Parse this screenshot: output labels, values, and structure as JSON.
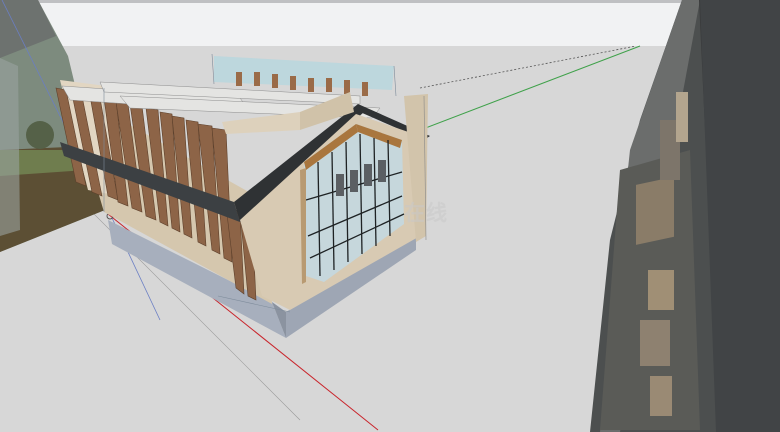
{
  "viewport": {
    "watermark_text": "在线",
    "colors": {
      "sky": "#f1f2f3",
      "ground": "#d7d7d7",
      "roof": "#3c4043",
      "wall": "#d8cab3",
      "wood_louver": "#8d6447",
      "glass": "#c6d7dc",
      "base": "#a7afbd",
      "axis_red": "#c9242b",
      "axis_green": "#3fa14a"
    },
    "icons": [
      "axis-origin-icon"
    ]
  }
}
